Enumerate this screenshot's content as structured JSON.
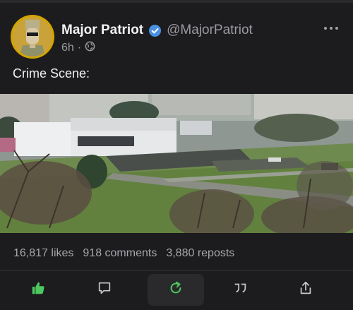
{
  "post": {
    "author_name": "Major Patriot",
    "handle": "@MajorPatriot",
    "time": "6h",
    "separator": "·",
    "text": "Crime Scene:"
  },
  "stats": {
    "likes": "16,817 likes",
    "comments": "918 comments",
    "reposts": "3,880 reposts"
  },
  "icons": {
    "verified": "verified-badge-icon",
    "globe": "globe-icon",
    "more": "more-options-icon",
    "like": "thumbs-up-icon",
    "comment": "comment-icon",
    "repost": "repost-icon",
    "quote": "quote-icon",
    "share": "share-icon"
  },
  "colors": {
    "background": "#1c1c1e",
    "verified_blue": "#4a90e2",
    "like_green": "#4cc860",
    "repost_green": "#4cc860",
    "avatar_ring": "#d4a400"
  }
}
